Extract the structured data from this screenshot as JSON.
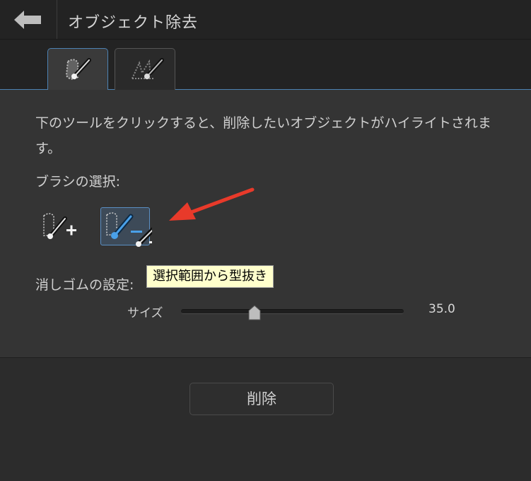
{
  "header": {
    "back_icon": "back-arrow-icon",
    "title": "オブジェクト除去"
  },
  "tabs": [
    {
      "icon": "brush-selection-icon",
      "active": true
    },
    {
      "icon": "line-brush-icon",
      "active": false
    }
  ],
  "panel": {
    "description": "下のツールをクリックすると、削除したいオブジェクトがハイライトされます。",
    "brush_label": "ブラシの選択:",
    "brushes": [
      {
        "icon": "brush-add-icon",
        "selected": false
      },
      {
        "icon": "brush-subtract-icon",
        "selected": true
      }
    ],
    "tooltip": "選択範囲から型抜き",
    "eraser_label": "消しゴムの設定:",
    "size": {
      "label": "サイズ",
      "value": "35.0",
      "fraction": 0.33
    }
  },
  "footer": {
    "delete_label": "削除"
  },
  "colors": {
    "accent": "#4d82b3",
    "brush_highlight": "#4aa0e8",
    "arrow": "#e83a2a",
    "tooltip_bg": "#ffffcc"
  }
}
